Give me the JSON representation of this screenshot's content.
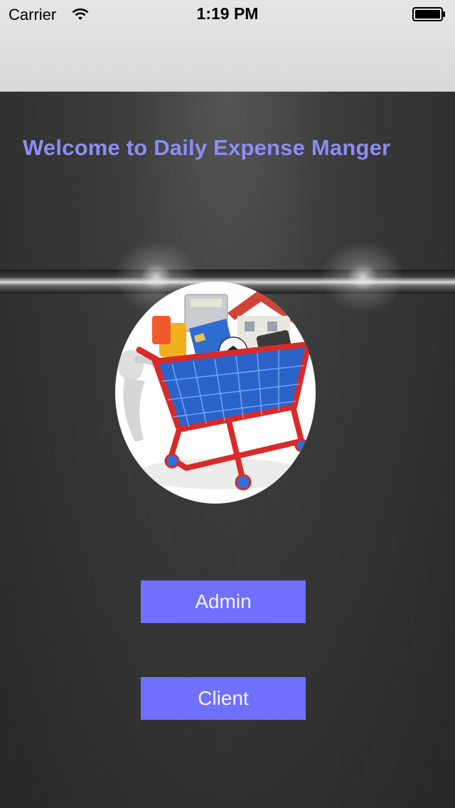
{
  "status_bar": {
    "carrier": "Carrier",
    "time": "1:19 PM",
    "icons": [
      "wifi-icon",
      "battery-icon"
    ]
  },
  "header": {
    "title": "Welcome to Daily Expense Manger"
  },
  "illustration": {
    "icon": "shopping-cart-icon"
  },
  "buttons": {
    "admin_label": "Admin",
    "client_label": "Client"
  },
  "colors": {
    "title": "#8c8cf6",
    "button_bg": "#7070ff",
    "button_text": "#f4f4ff",
    "nav_bar": "#e0e0e0",
    "background": "#2c2c2c"
  }
}
